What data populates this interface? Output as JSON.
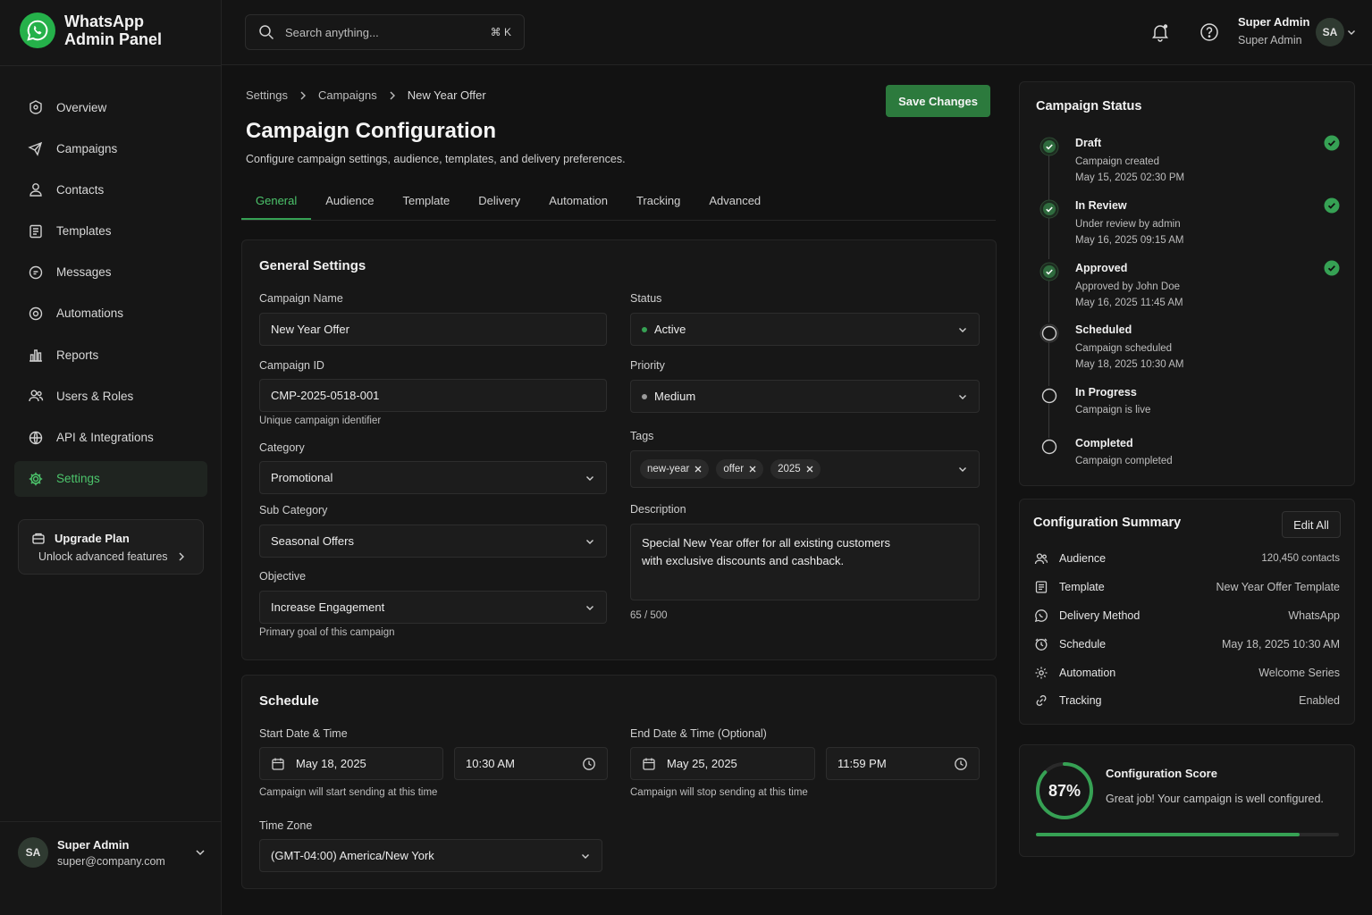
{
  "app": {
    "title_line1": "WhatsApp",
    "title_line2": "Admin Panel"
  },
  "sidebar": {
    "items": [
      {
        "label": "Overview",
        "icon": "overview-icon"
      },
      {
        "label": "Campaigns",
        "icon": "megaphone-icon"
      },
      {
        "label": "Contacts",
        "icon": "user-icon"
      },
      {
        "label": "Templates",
        "icon": "template-icon"
      },
      {
        "label": "Messages",
        "icon": "message-icon"
      },
      {
        "label": "Automations",
        "icon": "automation-icon"
      },
      {
        "label": "Reports",
        "icon": "reports-icon"
      },
      {
        "label": "Users & Roles",
        "icon": "users-icon"
      },
      {
        "label": "API & Integrations",
        "icon": "api-icon"
      },
      {
        "label": "Settings",
        "icon": "gear-icon",
        "active": true
      }
    ],
    "upgrade": {
      "title": "Upgrade Plan",
      "subtitle": "Unlock advanced features"
    },
    "user": {
      "initials": "SA",
      "name": "Super Admin",
      "email": "super@company.com"
    }
  },
  "topbar": {
    "search_placeholder": "Search anything...",
    "shortcut": "⌘ K",
    "user_name": "Super Admin",
    "user_role": "Super Admin",
    "user_initials": "SA"
  },
  "breadcrumb": [
    "Settings",
    "Campaigns",
    "New Year Offer"
  ],
  "page": {
    "title": "Campaign Configuration",
    "subtitle": "Configure campaign settings, audience, templates, and delivery preferences.",
    "save_label": "Save Changes"
  },
  "tabs": [
    "General",
    "Audience",
    "Template",
    "Delivery",
    "Automation",
    "Tracking",
    "Advanced"
  ],
  "general": {
    "title": "General Settings",
    "campaign_name_label": "Campaign Name",
    "campaign_name": "New Year Offer",
    "campaign_id_label": "Campaign ID",
    "campaign_id": "CMP-2025-0518-001",
    "campaign_id_help": "Unique campaign identifier",
    "category_label": "Category",
    "category": "Promotional",
    "subcategory_label": "Sub Category",
    "subcategory": "Seasonal Offers",
    "objective_label": "Objective",
    "objective": "Increase Engagement",
    "objective_help": "Primary goal of this campaign",
    "status_label": "Status",
    "status": "Active",
    "priority_label": "Priority",
    "priority": "Medium",
    "tags_label": "Tags",
    "tags": [
      "new-year",
      "offer",
      "2025"
    ],
    "description_label": "Description",
    "description_line1": "Special New Year offer for all existing customers",
    "description_line2": "with exclusive discounts and cashback.",
    "char_count": "65 / 500"
  },
  "schedule": {
    "title": "Schedule",
    "start_label": "Start Date & Time",
    "start_date": "May 18, 2025",
    "start_time": "10:30 AM",
    "start_help": "Campaign will start sending at this time",
    "end_label": "End Date & Time (Optional)",
    "end_date": "May 25, 2025",
    "end_time": "11:59 PM",
    "end_help": "Campaign will stop sending at this time",
    "timezone_label": "Time Zone",
    "timezone": "(GMT-04:00) America/New York"
  },
  "status_panel": {
    "title": "Campaign Status",
    "steps": [
      {
        "title": "Draft",
        "sub1": "Campaign created",
        "sub2": "May 15, 2025 02:30 PM",
        "done": true
      },
      {
        "title": "In Review",
        "sub1": "Under review by admin",
        "sub2": "May 16, 2025 09:15 AM",
        "done": true
      },
      {
        "title": "Approved",
        "sub1": "Approved by John Doe",
        "sub2": "May 16, 2025 11:45 AM",
        "done": true
      },
      {
        "title": "Scheduled",
        "sub1": "Campaign scheduled",
        "sub2": "May 18, 2025 10:30 AM",
        "done": false
      },
      {
        "title": "In Progress",
        "sub1": "Campaign is live",
        "sub2": "",
        "done": false
      },
      {
        "title": "Completed",
        "sub1": "Campaign completed",
        "sub2": "",
        "done": false
      }
    ]
  },
  "summary": {
    "title": "Configuration Summary",
    "edit_label": "Edit All",
    "rows": [
      {
        "key": "Audience",
        "value": "120,450 contacts",
        "icon": "users-icon"
      },
      {
        "key": "Template",
        "value": "New Year Offer Template",
        "icon": "template-icon"
      },
      {
        "key": "Delivery Method",
        "value": "WhatsApp",
        "icon": "whatsapp-icon"
      },
      {
        "key": "Schedule",
        "value": "May 18, 2025 10:30 AM",
        "icon": "clock-icon"
      },
      {
        "key": "Automation",
        "value": "Welcome Series",
        "icon": "automation-icon"
      },
      {
        "key": "Tracking",
        "value": "Enabled",
        "icon": "link-icon"
      }
    ]
  },
  "score": {
    "value_label": "87%",
    "value": 0.87,
    "title": "Configuration Score",
    "message": "Great job! Your campaign is well configured."
  },
  "colors": {
    "accent": "#36a154",
    "brand": "#25b14a",
    "background": "#121212"
  }
}
